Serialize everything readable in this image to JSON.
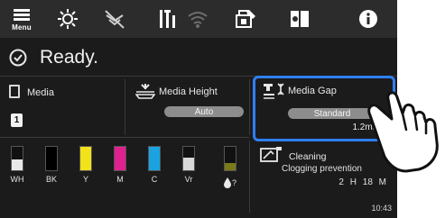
{
  "toolbar": {
    "menu_label": "Menu",
    "items": [
      {
        "icon": "sun-brightness-icon"
      },
      {
        "icon": "network-off-icon"
      },
      {
        "icon": "printer-settings-icon"
      },
      {
        "icon": "wifi-off-icon"
      },
      {
        "icon": "maintenance-icon"
      },
      {
        "icon": "book-guide-icon"
      },
      {
        "icon": "info-icon"
      }
    ]
  },
  "status": {
    "text": "Ready."
  },
  "media": {
    "label": "Media",
    "badge": "1"
  },
  "media_height": {
    "label": "Media Height",
    "value": "Auto"
  },
  "media_gap": {
    "label": "Media Gap",
    "value": "Standard",
    "measure": "1.2mm"
  },
  "inks": [
    {
      "label": "WH",
      "color": "#e8e8e8",
      "level": 0.45
    },
    {
      "label": "BK",
      "color": "#000000",
      "level": 1.0
    },
    {
      "label": "Y",
      "color": "#f2e21a",
      "level": 1.0
    },
    {
      "label": "M",
      "color": "#e0208f",
      "level": 1.0
    },
    {
      "label": "C",
      "color": "#1aa3e0",
      "level": 1.0
    },
    {
      "label": "Vr",
      "color": "#d8d8d8",
      "level": 0.55
    }
  ],
  "cleaning": {
    "title": "Cleaning",
    "subtitle": "Clogging prevention",
    "hours": "2 H",
    "minutes": "18 M"
  },
  "clock": "10:43",
  "colors": {
    "accent": "#2f7ff0",
    "background": "#1b1b1b",
    "toolbar": "#2c2c2c"
  }
}
